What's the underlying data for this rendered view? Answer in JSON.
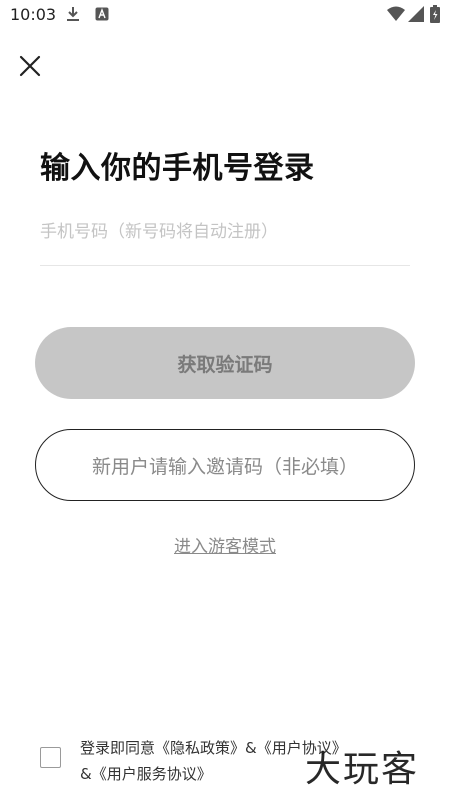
{
  "status_bar": {
    "time": "10:03",
    "icons": [
      "download-icon",
      "notification-a-icon",
      "wifi-icon",
      "signal-icon",
      "battery-icon"
    ]
  },
  "close_icon": "close-icon",
  "title": "输入你的手机号登录",
  "phone_input": {
    "value": "",
    "placeholder": "手机号码（新号码将自动注册）"
  },
  "buttons": {
    "get_code": "获取验证码",
    "invite": "新用户请输入邀请码（非必填）",
    "guest": "进入游客模式"
  },
  "agreement": {
    "checked": false,
    "prefix": "登录即同意",
    "privacy": "《隐私政策》",
    "amp1": "&",
    "user_agreement": "《用户协议》",
    "amp2": "&",
    "service_agreement": "《用户服务协议》"
  },
  "watermark": "大玩客",
  "colors": {
    "button_disabled_bg": "#c6c6c6",
    "button_disabled_text": "#7a7a7a",
    "outline_text": "#8a8a8a"
  }
}
